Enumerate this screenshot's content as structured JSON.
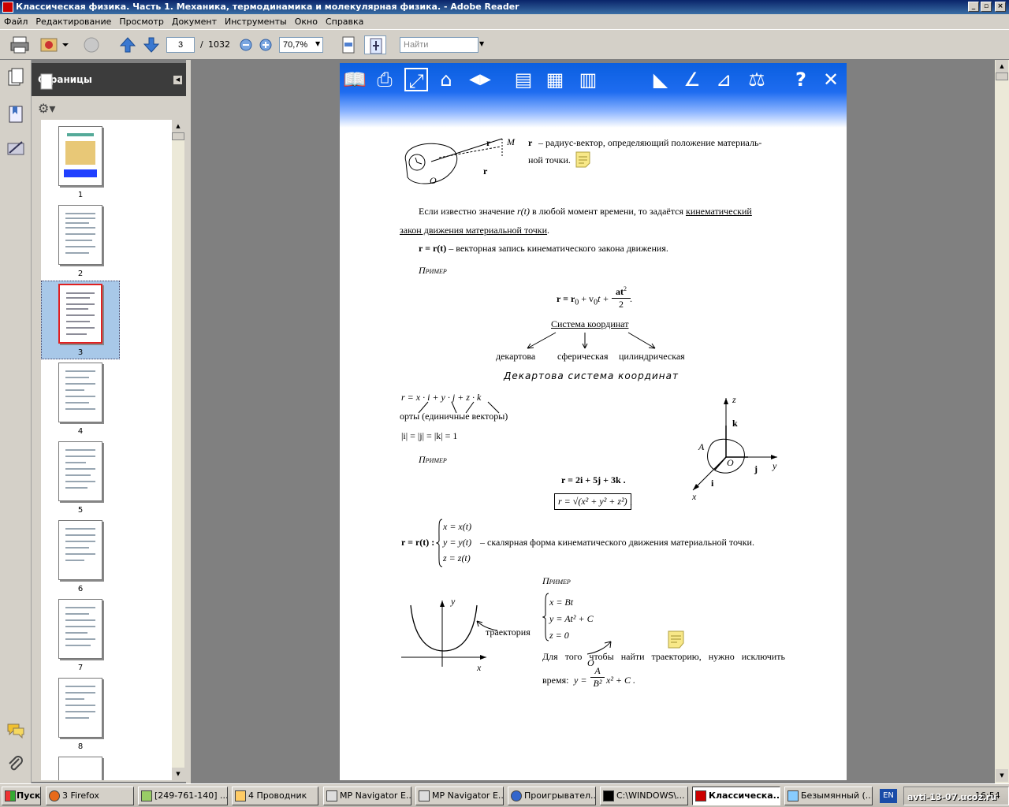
{
  "window": {
    "title": "Классическая физика. Часть 1. Механика, термодинамика и молекулярная физика. - Adobe Reader"
  },
  "menu": [
    "Файл",
    "Редактирование",
    "Просмотр",
    "Документ",
    "Инструменты",
    "Окно",
    "Справка"
  ],
  "toolbar": {
    "page_current": "3",
    "page_sep": "/",
    "page_total": "1032",
    "zoom": "70,7%",
    "search_placeholder": "Найти"
  },
  "pages_panel": {
    "title": "Страницы",
    "thumbs": [
      "1",
      "2",
      "3",
      "4",
      "5",
      "6",
      "7",
      "8"
    ],
    "selected": "3"
  },
  "document": {
    "r1": "r",
    "r_def": "– радиус-вектор, определяющий положение материаль-",
    "r_def2": "ной точки.",
    "fig_M": "M",
    "fig_O": "O",
    "fig_r": "r",
    "fig_r2": "r",
    "p1a": "Если известно значение ",
    "p1b": "r(t)",
    "p1c": " в любой момент времени, то задаётся ",
    "p1d": "кинематический",
    "p1e": "закон движения материальной точки",
    "p1f": ".",
    "p2a": "r = r(t)",
    "p2b": " – векторная запись кинематического закона движения.",
    "example": "Пример",
    "eq1a": "r = r",
    "eq1sub": "0",
    "eq1b": " + v",
    "eq1c": "t +",
    "eq1num": "at",
    "eq1sup": "2",
    "eq1den": "2",
    "eq1end": ".",
    "coord_title": "Система координат",
    "c1": "декартова",
    "c2": "сферическая",
    "c3": "цилиндрическая",
    "dekart_title": "Декартова система координат",
    "eq2": "r = x · i + y · j + z · k",
    "orts": "орты (единичные векторы)",
    "eq3": "|i| = |j| = |k| = 1",
    "example2": "Пример",
    "eq4": "r = 2i + 5j + 3k .",
    "eq5": "r = √(x² + y² + z²)",
    "eq5end": ".",
    "ax_z": "z",
    "ax_k": "k",
    "ax_A": "A",
    "ax_O": "O",
    "ax_j": "j",
    "ax_y": "y",
    "ax_i": "i",
    "ax_x": "x",
    "sys_l": "r = r(t) :",
    "sys1": "x = x(t)",
    "sys2": "y = y(t)",
    "sys3": "z = z(t)",
    "sys_r": "– скалярная форма кинематического движения материальной точки.",
    "example3": "Пример",
    "ex1": "x = Bt",
    "ex2": "y = At² + C",
    "ex3": "z = 0",
    "traj": "траектория",
    "g_y": "y",
    "g_x": "x",
    "final1": "Для того чтобы найти траекторию, нужно исключить",
    "final2a": "время:",
    "final2b": "y =",
    "final_num": "A",
    "final_den": "B²",
    "final2c": "x² + C .",
    "final_O": "O"
  },
  "taskbar": {
    "start": "Пуск",
    "tasks": [
      "3 Firefox",
      "[249-761-140] ...",
      "4 Проводник",
      "MP Navigator E...",
      "MP Navigator E...",
      "Проигрывател...",
      "C:\\WINDOWS\\...",
      "Классическа...",
      "Безымянный (..."
    ],
    "lang": "EN",
    "clock": "16:54",
    "watermark": "avti-13-07.ucoz.ru"
  }
}
